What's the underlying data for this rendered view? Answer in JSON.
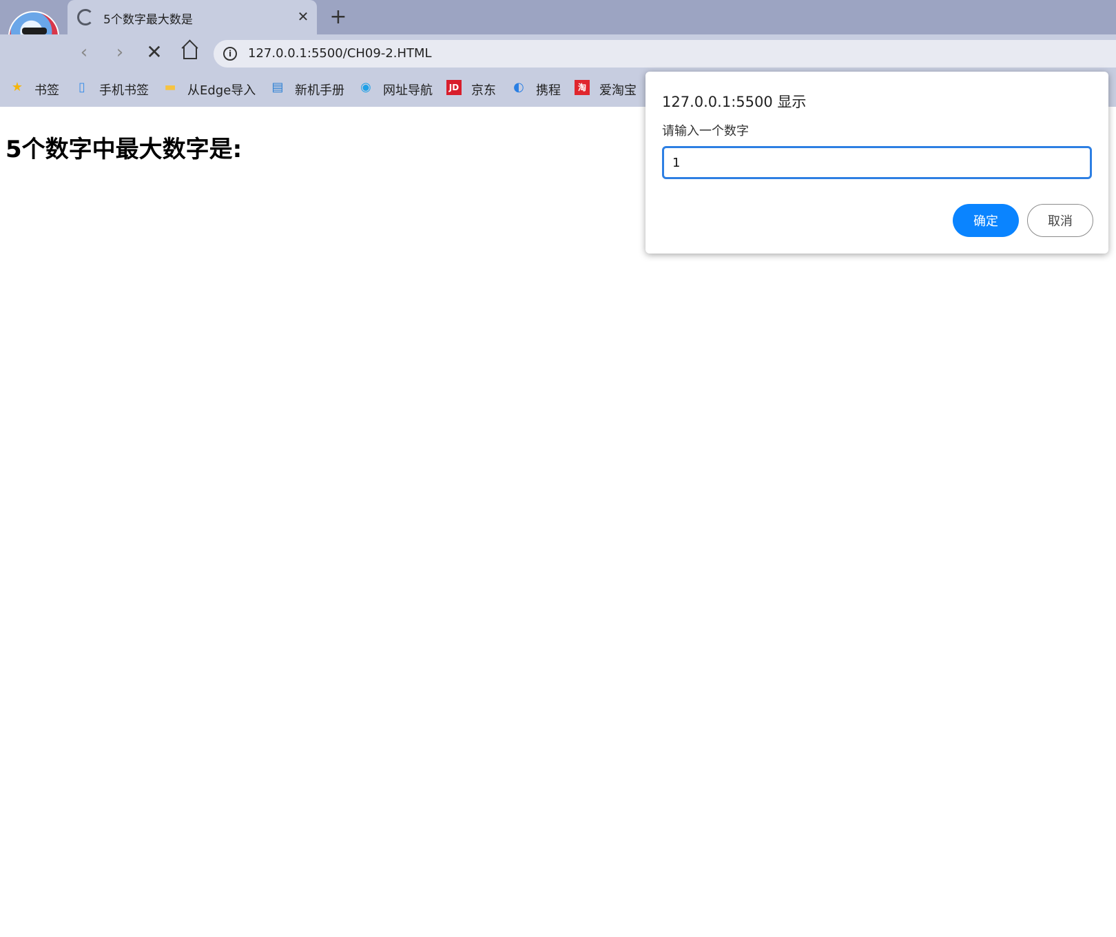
{
  "browser": {
    "tab": {
      "title": "5个数字最大数是"
    },
    "address_bar": {
      "url": "127.0.0.1:5500/CH09-2.HTML"
    },
    "bookmarks": [
      {
        "label": "书签",
        "icon": "star-icon",
        "color": "#f5b50a"
      },
      {
        "label": "手机书签",
        "icon": "mobile-bookmark-icon",
        "color": "#3b8ee8"
      },
      {
        "label": "从Edge导入",
        "icon": "folder-icon",
        "color": "#f6c342"
      },
      {
        "label": "新机手册",
        "icon": "manual-icon",
        "color": "#2a7fd4"
      },
      {
        "label": "网址导航",
        "icon": "edge-icon",
        "color": "#1fa0e6"
      },
      {
        "label": "京东",
        "icon": "jd-icon",
        "color": "#d81e2c"
      },
      {
        "label": "携程",
        "icon": "ctrip-icon",
        "color": "#2a7fe3"
      },
      {
        "label": "爱淘宝",
        "icon": "taobao-icon",
        "color": "#e0262d"
      }
    ]
  },
  "page": {
    "heading": "5个数字中最大数字是:"
  },
  "dialog": {
    "title": "127.0.0.1:5500 显示",
    "message": "请输入一个数字",
    "input_value": "1",
    "ok_label": "确定",
    "cancel_label": "取消"
  }
}
